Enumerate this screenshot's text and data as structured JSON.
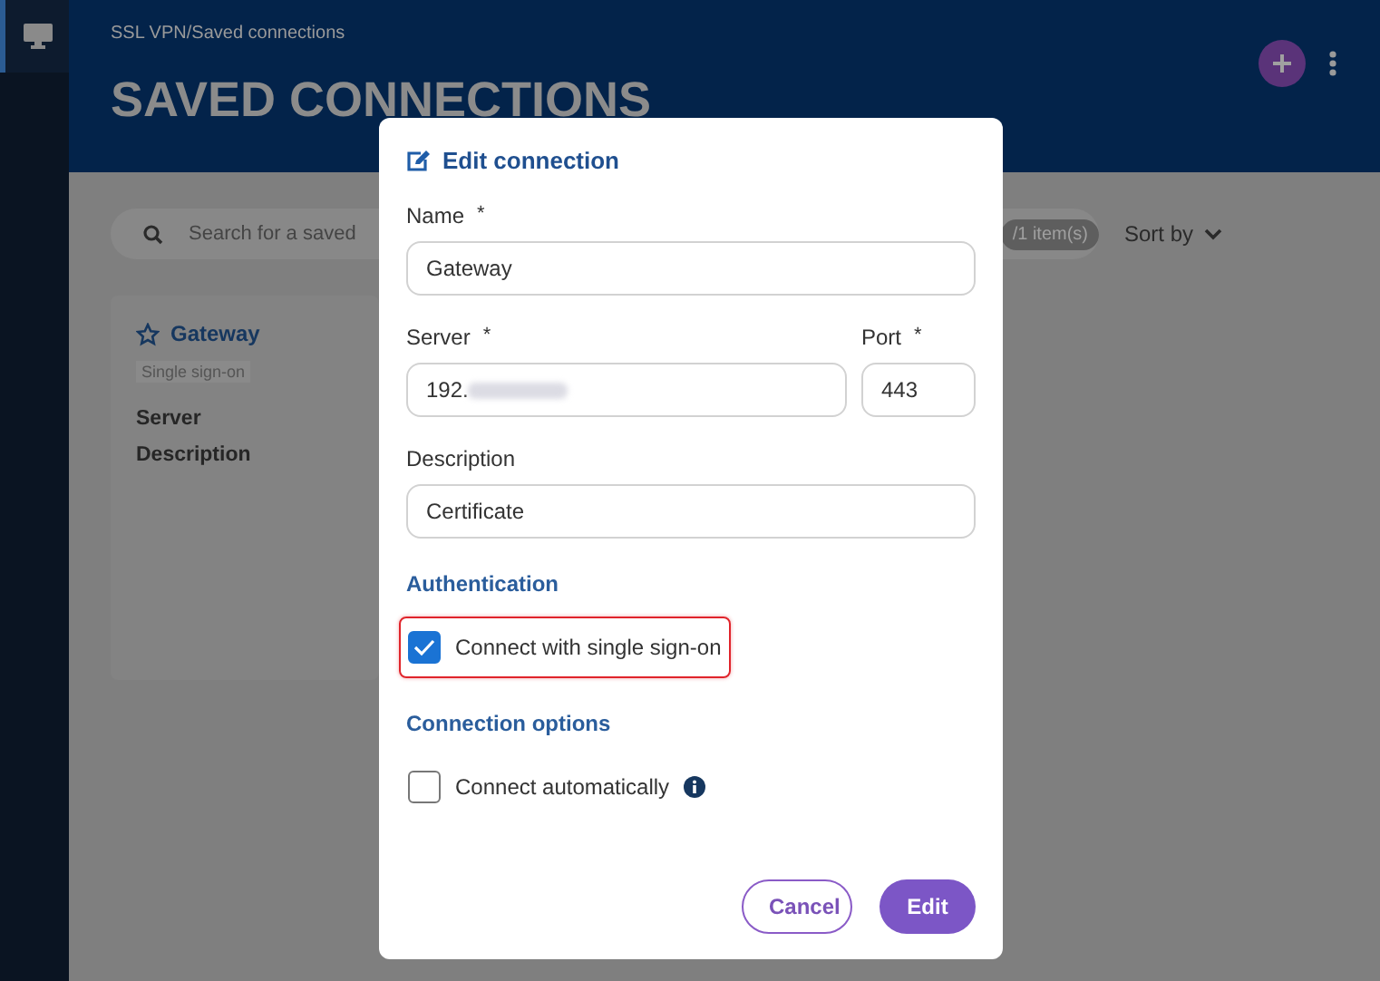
{
  "breadcrumb": "SSL VPN/Saved connections",
  "page_title": "SAVED CONNECTIONS",
  "search": {
    "placeholder": "Search for a saved"
  },
  "item_count": "/1 item(s)",
  "sort": {
    "label": "Sort by"
  },
  "card": {
    "name": "Gateway",
    "tag": "Single sign-on",
    "fields": [
      "Server",
      "Description"
    ]
  },
  "dialog": {
    "title": "Edit connection",
    "name": {
      "label": "Name",
      "required_mark": "*",
      "value": "Gateway"
    },
    "server": {
      "label": "Server",
      "required_mark": "*",
      "value": "192.",
      "redacted": true
    },
    "port": {
      "label": "Port",
      "required_mark": "*",
      "value": "443"
    },
    "description": {
      "label": "Description",
      "value": "Certificate"
    },
    "sections": [
      {
        "title": "Authentication",
        "options": [
          {
            "label": "Connect with single sign-on",
            "checked": true,
            "highlighted": true,
            "info": false
          }
        ]
      },
      {
        "title": "Connection options",
        "options": [
          {
            "label": "Connect automatically",
            "checked": false,
            "highlighted": false,
            "info": true
          }
        ]
      }
    ],
    "buttons": [
      {
        "label": "Cancel",
        "kind": "secondary"
      },
      {
        "label": "Edit",
        "kind": "primary"
      }
    ]
  }
}
